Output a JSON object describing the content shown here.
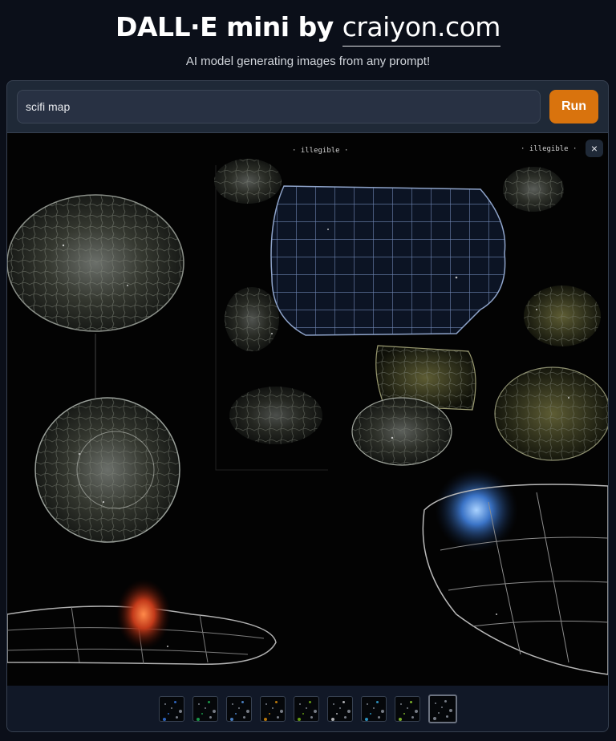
{
  "header": {
    "title_prefix": "DALL·E mini by ",
    "title_link": "craiyon.com",
    "subtitle": "AI model generating images from any prompt!"
  },
  "prompt": {
    "value": "scifi map",
    "placeholder": ""
  },
  "run_button": {
    "label": "Run"
  },
  "result": {
    "close_icon": "×",
    "image_caption_left": "· illegible ·",
    "image_caption_right": "· illegible ·"
  },
  "thumbnails": {
    "count": 9,
    "selected_index": 8,
    "accent_colors": [
      "#3b82f6",
      "#22c55e",
      "#60a5fa",
      "#f59e0b",
      "#84cc16",
      "#e5e7eb",
      "#38bdf8",
      "#a3e635",
      "#9ca3af"
    ]
  },
  "colors": {
    "background": "#0b0f19",
    "panel": "#1f2937",
    "run_button": "#d9730d"
  }
}
